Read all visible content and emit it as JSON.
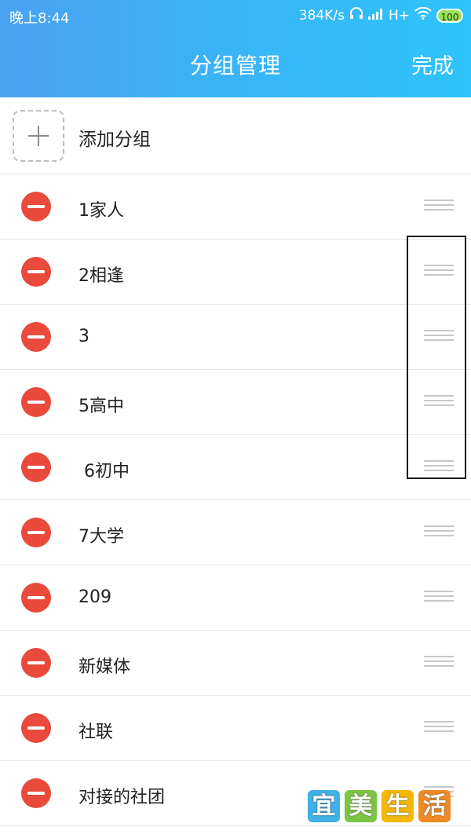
{
  "status_bar": {
    "time": "晚上8:44",
    "speed": "384K/s",
    "network": "H+",
    "battery": "100"
  },
  "header": {
    "title": "分组管理",
    "done_label": "完成"
  },
  "add_group": {
    "label": "添加分组"
  },
  "groups": [
    {
      "label": "1家人"
    },
    {
      "label": "2相逢"
    },
    {
      "label": "3"
    },
    {
      "label": "5高中"
    },
    {
      "label": " 6初中"
    },
    {
      "label": "7大学"
    },
    {
      "label": "209"
    },
    {
      "label": "新媒体"
    },
    {
      "label": "社联"
    },
    {
      "label": "对接的社团"
    }
  ],
  "watermark": {
    "chars": [
      "宜",
      "美",
      "生",
      "活"
    ],
    "colors": [
      "#3fb0e8",
      "#7cc444",
      "#f5b800",
      "#f08a24"
    ]
  },
  "colors": {
    "header_start": "#4aa2f3",
    "header_end": "#2ec3fb",
    "remove_red": "#e94a3b"
  }
}
